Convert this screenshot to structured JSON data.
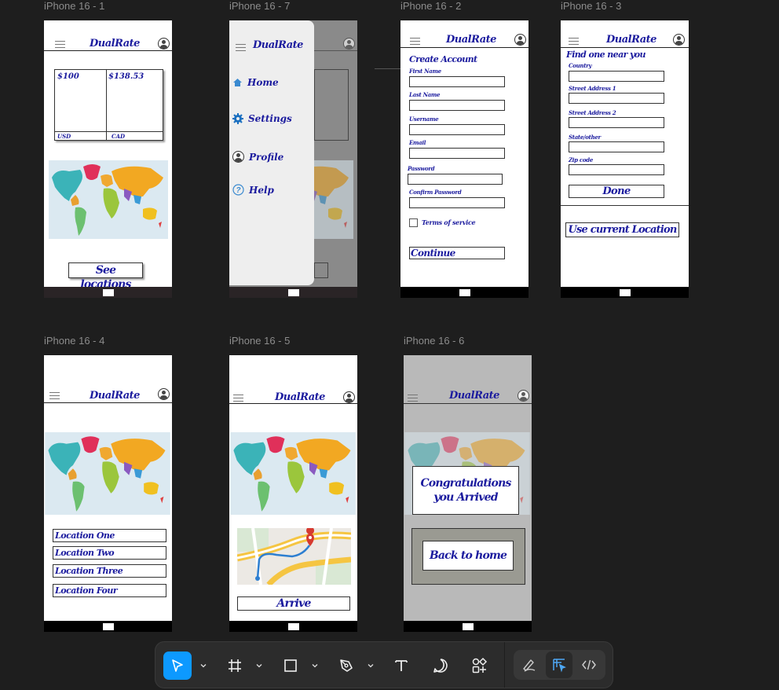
{
  "frame_labels": {
    "f1": "iPhone 16 - 1",
    "f7": "iPhone 16 - 7",
    "f2": "iPhone 16 - 2",
    "f3": "iPhone 16 - 3",
    "f4": "iPhone 16 - 4",
    "f5": "iPhone 16 - 5",
    "f6": "iPhone 16 - 6"
  },
  "app": {
    "brand": "DualRate"
  },
  "screen1": {
    "usd_value": "$100",
    "cad_value": "$138.53",
    "usd_label": "USD",
    "cad_label": "CAD",
    "see_locations": "See locations"
  },
  "screen7": {
    "menu": [
      {
        "label": "Home",
        "icon": "home-icon"
      },
      {
        "label": "Settings",
        "icon": "gear-icon"
      },
      {
        "label": "Profile",
        "icon": "profile-icon"
      },
      {
        "label": "Help",
        "icon": "help-icon"
      }
    ]
  },
  "screen2": {
    "title": "Create Account",
    "fields": [
      "First Name",
      "Last Name",
      "Username",
      "Email",
      "Password",
      "Confirm Password"
    ],
    "terms": "Terms of service",
    "continue": "Continue"
  },
  "screen3": {
    "title": "Find one near you",
    "fields": [
      "Country",
      "Street Address 1",
      "Street Address 2",
      "State/other",
      "Zip code"
    ],
    "done": "Done",
    "use_location": "Use current Location"
  },
  "screen4": {
    "locations": [
      "Location One",
      "Location Two",
      "Location Three",
      "Location Four"
    ]
  },
  "screen5": {
    "arrive": "Arrive"
  },
  "screen6": {
    "congrats": "Congratulations you Arrived",
    "back_home": "Back to home"
  },
  "toolbar": {
    "tools": [
      "move-tool",
      "frame-tool",
      "rectangle-tool",
      "pen-tool",
      "text-tool",
      "comment-tool",
      "components-tool",
      "draw-mode",
      "design-mode",
      "dev-mode"
    ],
    "active_tool": "move-tool",
    "accent": "#0d99ff"
  }
}
